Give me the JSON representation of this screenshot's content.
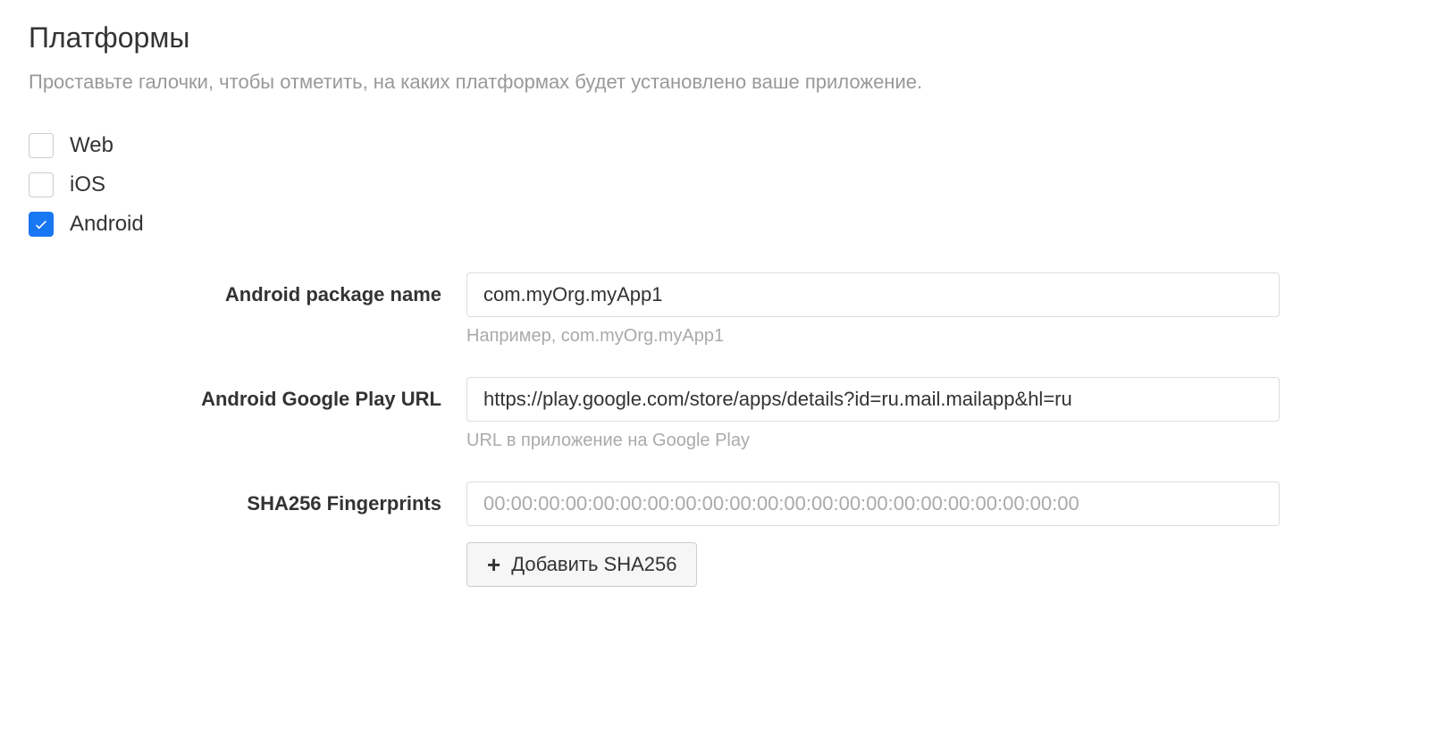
{
  "title": "Платформы",
  "subtitle": "Проставьте галочки, чтобы отметить, на каких платформах будет установлено ваше приложение.",
  "platforms": [
    {
      "label": "Web",
      "checked": false
    },
    {
      "label": "iOS",
      "checked": false
    },
    {
      "label": "Android",
      "checked": true
    }
  ],
  "fields": {
    "package_name": {
      "label": "Android package name",
      "value": "com.myOrg.myApp1",
      "help": "Например, com.myOrg.myApp1"
    },
    "play_url": {
      "label": "Android Google Play URL",
      "value": "https://play.google.com/store/apps/details?id=ru.mail.mailapp&hl=ru",
      "help": "URL в приложение на Google Play"
    },
    "sha256": {
      "label": "SHA256 Fingerprints",
      "placeholder": "00:00:00:00:00:00:00:00:00:00:00:00:00:00:00:00:00:00:00:00:00:00",
      "add_button": "Добавить SHA256"
    }
  }
}
